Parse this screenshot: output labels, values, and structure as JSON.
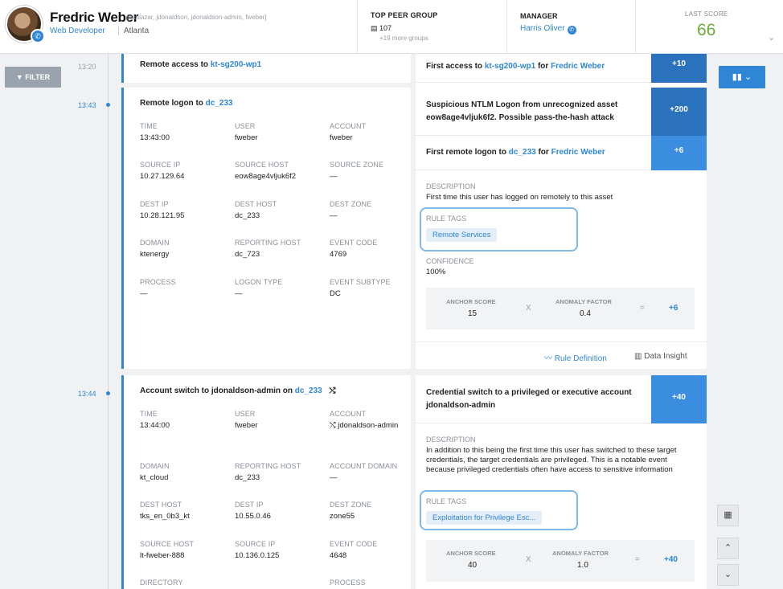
{
  "header": {
    "user_name": "Fredric Weber",
    "aliases": "[bsalazar, jdonaldson, jdonaldson-admin, fweber]",
    "role": "Web Developer",
    "location": "Atlanta",
    "peer_group_label": "TOP PEER GROUP",
    "peer_group_count": "107",
    "peer_group_more": "+19 more groups",
    "manager_label": "MANAGER",
    "manager_name": "Harris Oliver",
    "last_score_label": "LAST SCORE",
    "last_score_value": "66"
  },
  "controls": {
    "filter_label": "FILTER"
  },
  "timeline": {
    "times": [
      "13:20",
      "13:43",
      "13:44"
    ]
  },
  "events": {
    "e1": {
      "title_prefix": "Remote access to ",
      "title_link": "kt-sg200-wp1"
    },
    "e2": {
      "title_prefix": "Remote logon to ",
      "title_link": "dc_233",
      "fields": [
        {
          "label": "TIME",
          "value": "13:43:00"
        },
        {
          "label": "USER",
          "value": "fweber"
        },
        {
          "label": "ACCOUNT",
          "value": "fweber"
        },
        {
          "label": "SOURCE IP",
          "value": "10.27.129.64"
        },
        {
          "label": "SOURCE HOST",
          "value": "eow8age4vljuk6f2"
        },
        {
          "label": "SOURCE ZONE",
          "value": "—"
        },
        {
          "label": "DEST IP",
          "value": "10.28.121.95"
        },
        {
          "label": "DEST HOST",
          "value": "dc_233"
        },
        {
          "label": "DEST ZONE",
          "value": "—"
        },
        {
          "label": "DOMAIN",
          "value": "ktenergy"
        },
        {
          "label": "REPORTING HOST",
          "value": "dc_723"
        },
        {
          "label": "EVENT CODE",
          "value": "4769"
        },
        {
          "label": "PROCESS",
          "value": "—"
        },
        {
          "label": "LOGON TYPE",
          "value": "—"
        },
        {
          "label": "EVENT SUBTYPE",
          "value": "DC"
        }
      ]
    },
    "e3": {
      "title_prefix": "Account switch to jdonaldson-admin on ",
      "title_link": "dc_233",
      "fields": [
        {
          "label": "TIME",
          "value": "13:44:00"
        },
        {
          "label": "USER",
          "value": "fweber"
        },
        {
          "label": "ACCOUNT",
          "value": "⤭ jdonaldson-admin"
        },
        {
          "label": "DOMAIN",
          "value": "kt_cloud"
        },
        {
          "label": "REPORTING HOST",
          "value": "dc_233"
        },
        {
          "label": "ACCOUNT DOMAIN",
          "value": "—"
        },
        {
          "label": "DEST HOST",
          "value": "tks_en_0b3_kt"
        },
        {
          "label": "DEST IP",
          "value": "10.55.0.46"
        },
        {
          "label": "DEST ZONE",
          "value": "zone55"
        },
        {
          "label": "SOURCE HOST",
          "value": "lt-fweber-888"
        },
        {
          "label": "SOURCE IP",
          "value": "10.136.0.125"
        },
        {
          "label": "EVENT CODE",
          "value": "4648"
        },
        {
          "label": "DIRECTORY",
          "value": ""
        },
        {
          "label": "",
          "value": ""
        },
        {
          "label": "PROCESS",
          "value": ""
        }
      ]
    }
  },
  "rules": {
    "r1": {
      "text_a": "First access to ",
      "link_a": "kt-sg200-wp1",
      "text_b": " for ",
      "link_b": "Fredric Weber",
      "score": "+10"
    },
    "r2": {
      "text": "Suspicious NTLM Logon from unrecognized asset eow8age4vljuk6f2. Possible pass-the-hash attack",
      "score": "+200"
    },
    "r3": {
      "text_a": "First remote logon to ",
      "link_a": "dc_233",
      "text_b": " for ",
      "link_b": "Fredric Weber",
      "score": "+6"
    },
    "r3_detail": {
      "description_label": "DESCRIPTION",
      "description": "First time this user has logged on remotely to this asset",
      "rule_tags_label": "RULE TAGS",
      "tag": "Remote Services",
      "confidence_label": "CONFIDENCE",
      "confidence": "100%",
      "anchor_label": "ANCHOR SCORE",
      "anchor": "15",
      "x": "X",
      "anomaly_label": "ANOMALY FACTOR",
      "anomaly": "0.4",
      "eq": "=",
      "result": "+6",
      "rule_def": "Rule Definition",
      "data_insight": "Data Insight"
    },
    "r4": {
      "text": "Credential switch to a privileged or executive account jdonaldson-admin",
      "score": "+40"
    },
    "r4_detail": {
      "description_label": "DESCRIPTION",
      "description": "In addition to this being the first time this user has switched to these target credentials, the target credentials are privileged. This is a notable event because privileged credentials often have access to sensitive information",
      "rule_tags_label": "RULE TAGS",
      "tag": "Exploitation for Privilege Esc...",
      "anchor_label": "ANCHOR SCORE",
      "anchor": "40",
      "x": "X",
      "anomaly_label": "ANOMALY FACTOR",
      "anomaly": "1.0",
      "eq": "=",
      "result": "+40"
    }
  },
  "colors": {
    "accent": "#2f86d6",
    "score_dark": "#2b72bd",
    "score_mid": "#3b8de0",
    "score_green": "#6aaa3c"
  },
  "icons": [
    "phone-icon",
    "filter-icon",
    "bar-chart-icon",
    "chevron-down-icon",
    "chevron-up-icon",
    "calendar-icon",
    "shuffle-icon",
    "rule-definition-icon",
    "data-insight-icon",
    "document-icon"
  ]
}
